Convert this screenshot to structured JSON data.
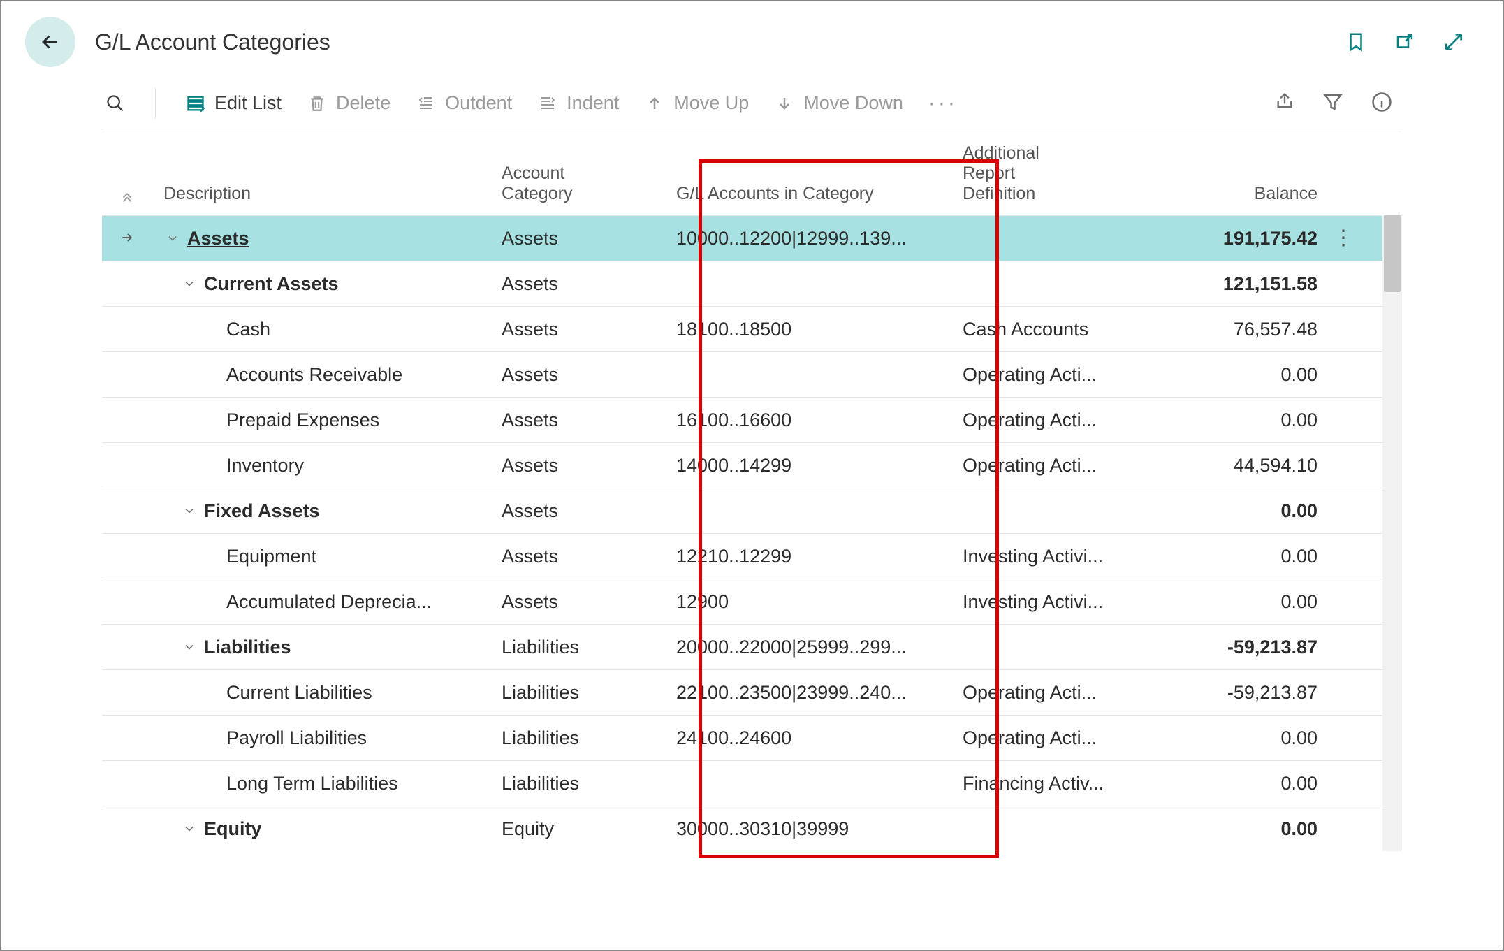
{
  "page_title": "G/L Account Categories",
  "actions": {
    "edit_list": "Edit List",
    "delete": "Delete",
    "outdent": "Outdent",
    "indent": "Indent",
    "move_up": "Move Up",
    "move_down": "Move Down"
  },
  "columns": {
    "description": "Description",
    "account_category": "Account\nCategory",
    "gl_accounts": "G/L Accounts in Category",
    "additional": "Additional\nReport\nDefinition",
    "balance": "Balance"
  },
  "rows": [
    {
      "level": 0,
      "desc": "Assets",
      "bold": true,
      "link": true,
      "expandable": true,
      "selected": true,
      "category": "Assets",
      "gl": "10000..12200|12999..139...",
      "additional": "",
      "balance": "191,175.42",
      "bal_bold": true
    },
    {
      "level": 1,
      "desc": "Current Assets",
      "bold": true,
      "expandable": true,
      "category": "Assets",
      "gl": "",
      "additional": "",
      "balance": "121,151.58",
      "bal_bold": true
    },
    {
      "level": 2,
      "desc": "Cash",
      "category": "Assets",
      "gl": "18100..18500",
      "additional": "Cash Accounts",
      "balance": "76,557.48"
    },
    {
      "level": 2,
      "desc": "Accounts Receivable",
      "category": "Assets",
      "gl": "",
      "additional": "Operating Acti...",
      "balance": "0.00"
    },
    {
      "level": 2,
      "desc": "Prepaid Expenses",
      "category": "Assets",
      "gl": "16100..16600",
      "additional": "Operating Acti...",
      "balance": "0.00"
    },
    {
      "level": 2,
      "desc": "Inventory",
      "category": "Assets",
      "gl": "14000..14299",
      "additional": "Operating Acti...",
      "balance": "44,594.10"
    },
    {
      "level": 1,
      "desc": "Fixed Assets",
      "bold": true,
      "expandable": true,
      "category": "Assets",
      "gl": "",
      "additional": "",
      "balance": "0.00",
      "bal_bold": true
    },
    {
      "level": 2,
      "desc": "Equipment",
      "category": "Assets",
      "gl": "12210..12299",
      "additional": "Investing Activi...",
      "balance": "0.00"
    },
    {
      "level": 2,
      "desc": "Accumulated Deprecia...",
      "category": "Assets",
      "gl": "12900",
      "additional": "Investing Activi...",
      "balance": "0.00"
    },
    {
      "level": 1,
      "desc": "Liabilities",
      "bold": true,
      "expandable": true,
      "category": "Liabilities",
      "gl": "20000..22000|25999..299...",
      "additional": "",
      "balance": "-59,213.87",
      "bal_bold": true
    },
    {
      "level": 2,
      "desc": "Current Liabilities",
      "category": "Liabilities",
      "gl": "22100..23500|23999..240...",
      "additional": "Operating Acti...",
      "balance": "-59,213.87"
    },
    {
      "level": 2,
      "desc": "Payroll Liabilities",
      "category": "Liabilities",
      "gl": "24100..24600",
      "additional": "Operating Acti...",
      "balance": "0.00"
    },
    {
      "level": 2,
      "desc": "Long Term Liabilities",
      "category": "Liabilities",
      "gl": "",
      "additional": "Financing Activ...",
      "balance": "0.00"
    },
    {
      "level": 1,
      "desc": "Equity",
      "bold": true,
      "expandable": true,
      "category": "Equity",
      "gl": "30000..30310|39999",
      "additional": "",
      "balance": "0.00",
      "bal_bold": true
    }
  ]
}
